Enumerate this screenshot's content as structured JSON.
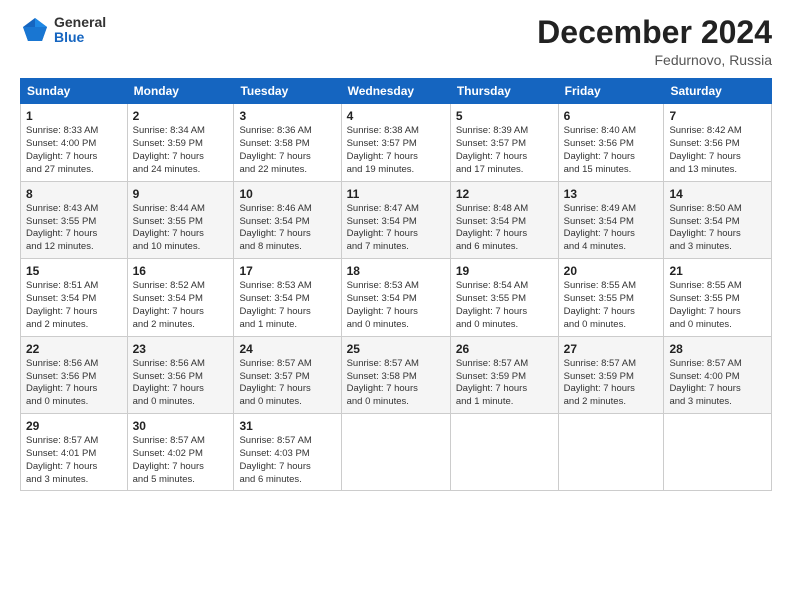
{
  "logo": {
    "general": "General",
    "blue": "Blue"
  },
  "title": "December 2024",
  "location": "Fedurnovo, Russia",
  "days_of_week": [
    "Sunday",
    "Monday",
    "Tuesday",
    "Wednesday",
    "Thursday",
    "Friday",
    "Saturday"
  ],
  "weeks": [
    [
      {
        "day": "1",
        "info": "Sunrise: 8:33 AM\nSunset: 4:00 PM\nDaylight: 7 hours\nand 27 minutes."
      },
      {
        "day": "2",
        "info": "Sunrise: 8:34 AM\nSunset: 3:59 PM\nDaylight: 7 hours\nand 24 minutes."
      },
      {
        "day": "3",
        "info": "Sunrise: 8:36 AM\nSunset: 3:58 PM\nDaylight: 7 hours\nand 22 minutes."
      },
      {
        "day": "4",
        "info": "Sunrise: 8:38 AM\nSunset: 3:57 PM\nDaylight: 7 hours\nand 19 minutes."
      },
      {
        "day": "5",
        "info": "Sunrise: 8:39 AM\nSunset: 3:57 PM\nDaylight: 7 hours\nand 17 minutes."
      },
      {
        "day": "6",
        "info": "Sunrise: 8:40 AM\nSunset: 3:56 PM\nDaylight: 7 hours\nand 15 minutes."
      },
      {
        "day": "7",
        "info": "Sunrise: 8:42 AM\nSunset: 3:56 PM\nDaylight: 7 hours\nand 13 minutes."
      }
    ],
    [
      {
        "day": "8",
        "info": "Sunrise: 8:43 AM\nSunset: 3:55 PM\nDaylight: 7 hours\nand 12 minutes."
      },
      {
        "day": "9",
        "info": "Sunrise: 8:44 AM\nSunset: 3:55 PM\nDaylight: 7 hours\nand 10 minutes."
      },
      {
        "day": "10",
        "info": "Sunrise: 8:46 AM\nSunset: 3:54 PM\nDaylight: 7 hours\nand 8 minutes."
      },
      {
        "day": "11",
        "info": "Sunrise: 8:47 AM\nSunset: 3:54 PM\nDaylight: 7 hours\nand 7 minutes."
      },
      {
        "day": "12",
        "info": "Sunrise: 8:48 AM\nSunset: 3:54 PM\nDaylight: 7 hours\nand 6 minutes."
      },
      {
        "day": "13",
        "info": "Sunrise: 8:49 AM\nSunset: 3:54 PM\nDaylight: 7 hours\nand 4 minutes."
      },
      {
        "day": "14",
        "info": "Sunrise: 8:50 AM\nSunset: 3:54 PM\nDaylight: 7 hours\nand 3 minutes."
      }
    ],
    [
      {
        "day": "15",
        "info": "Sunrise: 8:51 AM\nSunset: 3:54 PM\nDaylight: 7 hours\nand 2 minutes."
      },
      {
        "day": "16",
        "info": "Sunrise: 8:52 AM\nSunset: 3:54 PM\nDaylight: 7 hours\nand 2 minutes."
      },
      {
        "day": "17",
        "info": "Sunrise: 8:53 AM\nSunset: 3:54 PM\nDaylight: 7 hours\nand 1 minute."
      },
      {
        "day": "18",
        "info": "Sunrise: 8:53 AM\nSunset: 3:54 PM\nDaylight: 7 hours\nand 0 minutes."
      },
      {
        "day": "19",
        "info": "Sunrise: 8:54 AM\nSunset: 3:55 PM\nDaylight: 7 hours\nand 0 minutes."
      },
      {
        "day": "20",
        "info": "Sunrise: 8:55 AM\nSunset: 3:55 PM\nDaylight: 7 hours\nand 0 minutes."
      },
      {
        "day": "21",
        "info": "Sunrise: 8:55 AM\nSunset: 3:55 PM\nDaylight: 7 hours\nand 0 minutes."
      }
    ],
    [
      {
        "day": "22",
        "info": "Sunrise: 8:56 AM\nSunset: 3:56 PM\nDaylight: 7 hours\nand 0 minutes."
      },
      {
        "day": "23",
        "info": "Sunrise: 8:56 AM\nSunset: 3:56 PM\nDaylight: 7 hours\nand 0 minutes."
      },
      {
        "day": "24",
        "info": "Sunrise: 8:57 AM\nSunset: 3:57 PM\nDaylight: 7 hours\nand 0 minutes."
      },
      {
        "day": "25",
        "info": "Sunrise: 8:57 AM\nSunset: 3:58 PM\nDaylight: 7 hours\nand 0 minutes."
      },
      {
        "day": "26",
        "info": "Sunrise: 8:57 AM\nSunset: 3:59 PM\nDaylight: 7 hours\nand 1 minute."
      },
      {
        "day": "27",
        "info": "Sunrise: 8:57 AM\nSunset: 3:59 PM\nDaylight: 7 hours\nand 2 minutes."
      },
      {
        "day": "28",
        "info": "Sunrise: 8:57 AM\nSunset: 4:00 PM\nDaylight: 7 hours\nand 3 minutes."
      }
    ],
    [
      {
        "day": "29",
        "info": "Sunrise: 8:57 AM\nSunset: 4:01 PM\nDaylight: 7 hours\nand 3 minutes."
      },
      {
        "day": "30",
        "info": "Sunrise: 8:57 AM\nSunset: 4:02 PM\nDaylight: 7 hours\nand 5 minutes."
      },
      {
        "day": "31",
        "info": "Sunrise: 8:57 AM\nSunset: 4:03 PM\nDaylight: 7 hours\nand 6 minutes."
      },
      {
        "day": "",
        "info": ""
      },
      {
        "day": "",
        "info": ""
      },
      {
        "day": "",
        "info": ""
      },
      {
        "day": "",
        "info": ""
      }
    ]
  ]
}
